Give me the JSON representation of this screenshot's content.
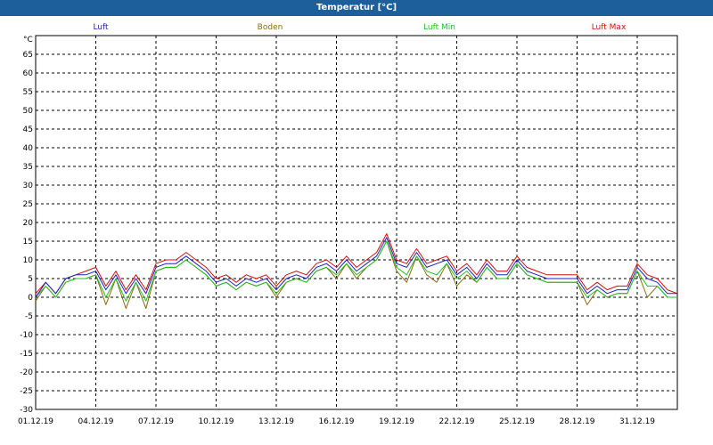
{
  "window": {
    "title": "Temperatur [°C]"
  },
  "colors": {
    "titlebar": "#1d5f9a",
    "luft": "#2020c0",
    "boden": "#8a6a10",
    "luft_min": "#20c020",
    "luft_max": "#d01010"
  },
  "chart_data": {
    "type": "line",
    "title": "Temperatur [°C]",
    "ylabel": "°C",
    "ylim": [
      -30,
      70
    ],
    "yticks": [
      -30,
      -25,
      -20,
      -15,
      -10,
      -5,
      0,
      5,
      10,
      15,
      20,
      25,
      30,
      35,
      40,
      45,
      50,
      55,
      60,
      65
    ],
    "xlim": [
      "2019-12-01",
      "2020-01-02"
    ],
    "xticks": [
      "01.12.19",
      "04.12.19",
      "07.12.19",
      "10.12.19",
      "13.12.19",
      "16.12.19",
      "19.12.19",
      "22.12.19",
      "25.12.19",
      "28.12.19",
      "31.12.19"
    ],
    "grid": true,
    "legend_position": "top",
    "x": [
      "2019-12-01",
      "2019-12-01 12:00",
      "2019-12-02",
      "2019-12-02 12:00",
      "2019-12-03",
      "2019-12-03 12:00",
      "2019-12-04",
      "2019-12-04 12:00",
      "2019-12-05",
      "2019-12-05 12:00",
      "2019-12-06",
      "2019-12-06 12:00",
      "2019-12-07",
      "2019-12-07 12:00",
      "2019-12-08",
      "2019-12-08 12:00",
      "2019-12-09",
      "2019-12-09 12:00",
      "2019-12-10",
      "2019-12-10 12:00",
      "2019-12-11",
      "2019-12-11 12:00",
      "2019-12-12",
      "2019-12-12 12:00",
      "2019-12-13",
      "2019-12-13 12:00",
      "2019-12-14",
      "2019-12-14 12:00",
      "2019-12-15",
      "2019-12-15 12:00",
      "2019-12-16",
      "2019-12-16 12:00",
      "2019-12-17",
      "2019-12-17 12:00",
      "2019-12-18",
      "2019-12-18 12:00",
      "2019-12-19",
      "2019-12-19 12:00",
      "2019-12-20",
      "2019-12-20 12:00",
      "2019-12-21",
      "2019-12-21 12:00",
      "2019-12-22",
      "2019-12-22 12:00",
      "2019-12-23",
      "2019-12-23 12:00",
      "2019-12-24",
      "2019-12-24 12:00",
      "2019-12-25",
      "2019-12-25 12:00",
      "2019-12-26",
      "2019-12-26 12:00",
      "2019-12-27",
      "2019-12-27 12:00",
      "2019-12-28",
      "2019-12-28 12:00",
      "2019-12-29",
      "2019-12-29 12:00",
      "2019-12-30",
      "2019-12-30 12:00",
      "2019-12-31",
      "2019-12-31 12:00",
      "2020-01-01",
      "2020-01-01 12:00",
      "2020-01-02"
    ],
    "series": [
      {
        "name": "Luft",
        "color": "#2020c0",
        "values": [
          0,
          4,
          1,
          5,
          6,
          6,
          7,
          2,
          6,
          1,
          5,
          1,
          8,
          9,
          9,
          11,
          9,
          7,
          4,
          5,
          3,
          5,
          4,
          5,
          2,
          5,
          6,
          5,
          8,
          9,
          7,
          10,
          7,
          9,
          11,
          16,
          9,
          8,
          12,
          8,
          9,
          10,
          6,
          8,
          5,
          9,
          6,
          6,
          10,
          7,
          6,
          5,
          5,
          5,
          5,
          1,
          3,
          1,
          2,
          2,
          8,
          5,
          4,
          1,
          1
        ]
      },
      {
        "name": "Boden",
        "color": "#8a6a10",
        "values": [
          -1,
          3,
          0,
          4,
          5,
          5,
          6,
          -2,
          5,
          -3,
          4,
          -3,
          7,
          8,
          8,
          10,
          8,
          6,
          3,
          4,
          2,
          4,
          3,
          4,
          0,
          4,
          5,
          4,
          7,
          8,
          5,
          9,
          5,
          8,
          10,
          15,
          7,
          4,
          11,
          6,
          4,
          9,
          3,
          6,
          4,
          8,
          5,
          5,
          9,
          6,
          5,
          4,
          4,
          4,
          4,
          -2,
          2,
          0,
          1,
          1,
          7,
          0,
          3,
          0,
          0
        ]
      },
      {
        "name": "Luft Min",
        "color": "#20c020",
        "values": [
          0,
          3,
          0,
          4,
          5,
          5,
          6,
          0,
          5,
          -1,
          4,
          -1,
          7,
          8,
          8,
          10,
          8,
          6,
          3,
          4,
          2,
          4,
          3,
          4,
          1,
          4,
          5,
          4,
          7,
          8,
          6,
          9,
          6,
          8,
          10,
          15,
          8,
          6,
          11,
          7,
          6,
          9,
          5,
          7,
          4,
          8,
          5,
          5,
          9,
          6,
          5,
          4,
          4,
          4,
          4,
          0,
          2,
          0,
          1,
          1,
          7,
          3,
          3,
          0,
          0
        ]
      },
      {
        "name": "Luft Max",
        "color": "#d01010",
        "values": [
          1,
          4,
          1,
          5,
          6,
          7,
          8,
          3,
          7,
          2,
          6,
          2,
          9,
          10,
          10,
          12,
          10,
          8,
          5,
          6,
          4,
          6,
          5,
          6,
          3,
          6,
          7,
          6,
          9,
          10,
          8,
          11,
          8,
          10,
          12,
          17,
          10,
          9,
          13,
          9,
          10,
          11,
          7,
          9,
          6,
          10,
          7,
          7,
          11,
          8,
          7,
          6,
          6,
          6,
          6,
          2,
          4,
          2,
          3,
          3,
          9,
          6,
          5,
          2,
          1
        ]
      }
    ]
  }
}
